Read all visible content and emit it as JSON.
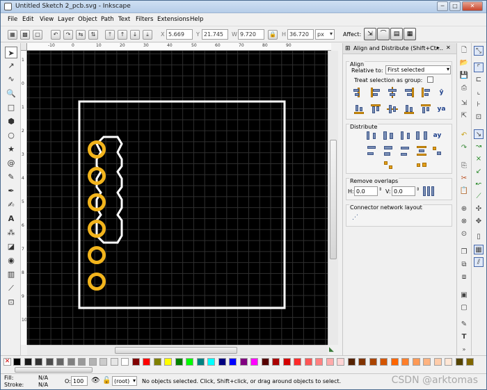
{
  "window": {
    "title": "Untitled Sketch 2_pcb.svg - Inkscape",
    "min": "─",
    "max": "□",
    "close": "✕"
  },
  "menu": [
    "File",
    "Edit",
    "View",
    "Layer",
    "Object",
    "Path",
    "Text",
    "Filters",
    "Extensions",
    "Help"
  ],
  "toolbar": {
    "x_label": "X",
    "x_value": "5.669",
    "y_label": "Y",
    "y_value": "21.745",
    "w_label": "W",
    "w_value": "9.720",
    "h_label": "H",
    "h_value": "36.720",
    "unit": "px",
    "affect_label": "Affect:"
  },
  "ruler_top": [
    "-10",
    "0",
    "10",
    "20",
    "30",
    "40",
    "50",
    "60",
    "70",
    "80",
    "90"
  ],
  "ruler_left": [
    "1",
    "0",
    "1",
    "2",
    "3",
    "4",
    "5",
    "6",
    "7",
    "8",
    "9",
    "10"
  ],
  "dock": {
    "title": "Align and Distribute (Shift+Ctr...",
    "align_title": "Align",
    "relative_label": "Relative to:",
    "relative_value": "First selected",
    "group_label": "Treat selection as group:",
    "distribute_title": "Distribute",
    "overlap_title": "Remove overlaps",
    "h_label": "H:",
    "h_value": "0.0",
    "v_label": "V:",
    "v_value": "0.0",
    "connector_title": "Connector network layout"
  },
  "status": {
    "fill_label": "Fill:",
    "fill_value": "N/A",
    "stroke_label": "Stroke:",
    "stroke_value": "N/A",
    "opacity_label": "O:",
    "opacity_value": "100",
    "layer_value": "(root)",
    "message": "No objects selected. Click, Shift+click, or drag around objects to select.",
    "watermark": "CSDN @arktomas"
  },
  "colors": {
    "canvas_bg": "#000000",
    "outline": "#ffffff",
    "pad": "#f2b41c",
    "grid": "#2f2f2f"
  },
  "palette": [
    "#000000",
    "#1a1a1a",
    "#333333",
    "#4d4d4d",
    "#666666",
    "#808080",
    "#999999",
    "#b3b3b3",
    "#cccccc",
    "#e6e6e6",
    "#ffffff",
    "#800000",
    "#ff0000",
    "#808000",
    "#ffff00",
    "#008000",
    "#00ff00",
    "#008080",
    "#00ffff",
    "#000080",
    "#0000ff",
    "#800080",
    "#ff00ff",
    "#550000",
    "#aa0000",
    "#d40000",
    "#ff2a2a",
    "#ff5555",
    "#ff8080",
    "#ffaaaa",
    "#ffd5d5",
    "#552200",
    "#803300",
    "#aa4400",
    "#d45500",
    "#ff6600",
    "#ff7f2a",
    "#ff9955",
    "#ffb380",
    "#ffccaa",
    "#ffe6d5",
    "#554400",
    "#806600"
  ]
}
